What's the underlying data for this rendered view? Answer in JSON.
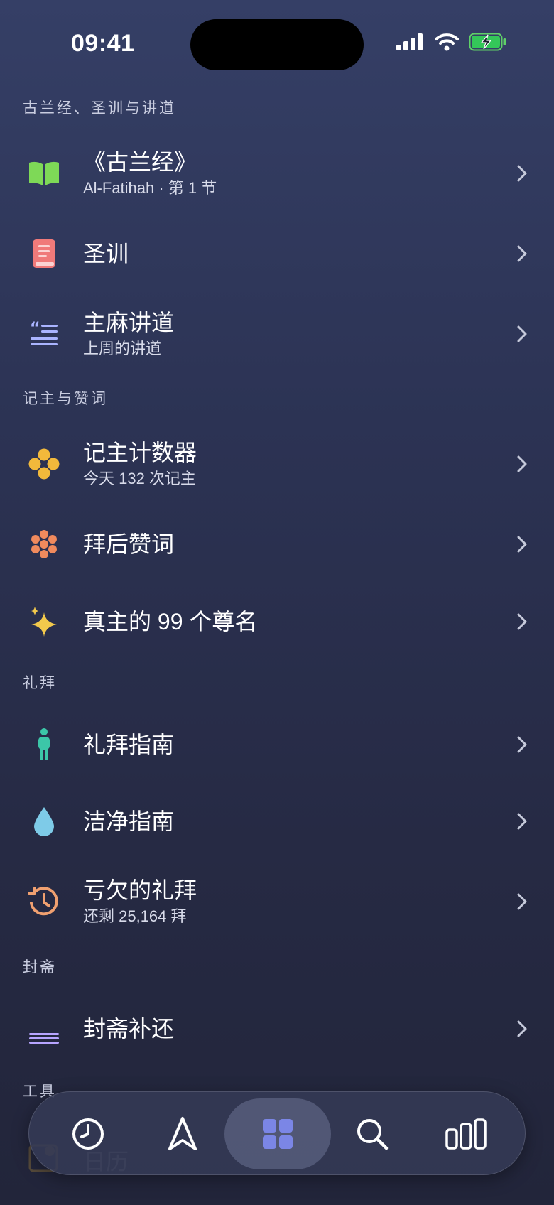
{
  "status_bar": {
    "time": "09:41"
  },
  "sections": {
    "quran": "古兰经、圣训与讲道",
    "dhikr": "记主与赞词",
    "prayer": "礼拜",
    "fasting": "封斋",
    "tools": "工具"
  },
  "rows": {
    "quran": {
      "title": "《古兰经》",
      "subtitle": "Al-Fatihah · 第 1 节",
      "icon": "open-book-icon",
      "color": "#7ed957"
    },
    "hadith": {
      "title": "圣训",
      "icon": "book-icon",
      "color": "#f07a7a"
    },
    "sermon": {
      "title": "主麻讲道",
      "subtitle": "上周的讲道",
      "icon": "quote-lines-icon",
      "color": "#aab4ff"
    },
    "counter": {
      "title": "记主计数器",
      "subtitle": "今天 132 次记主",
      "icon": "beads-icon",
      "color": "#f2b93b"
    },
    "after_prayer": {
      "title": "拜后赞词",
      "icon": "flower-icon",
      "color": "#f08a5d"
    },
    "names": {
      "title": "真主的 99 个尊名",
      "icon": "sparkles-icon",
      "color": "#f2c94c"
    },
    "prayer_guide": {
      "title": "礼拜指南",
      "icon": "person-icon",
      "color": "#3cc6a8"
    },
    "wudu_guide": {
      "title": "洁净指南",
      "icon": "water-drop-icon",
      "color": "#7ecbe8"
    },
    "missed_prayers": {
      "title": "亏欠的礼拜",
      "subtitle": "还剩 25,164 拜",
      "icon": "history-icon",
      "color": "#f0a070"
    },
    "fasting_makeup": {
      "title": "封斋补还",
      "icon": "moon-icon",
      "color": "#b7a4ff"
    },
    "calendar": {
      "title": "日历",
      "icon": "calendar-icon",
      "color": "#f2b93b"
    }
  },
  "tab_bar": {
    "tabs": [
      {
        "name": "clock-icon",
        "active": false
      },
      {
        "name": "compass-icon",
        "active": false
      },
      {
        "name": "grid-icon",
        "active": true
      },
      {
        "name": "search-icon",
        "active": false
      },
      {
        "name": "stats-icon",
        "active": false
      }
    ],
    "active_color": "#7b86e6"
  }
}
